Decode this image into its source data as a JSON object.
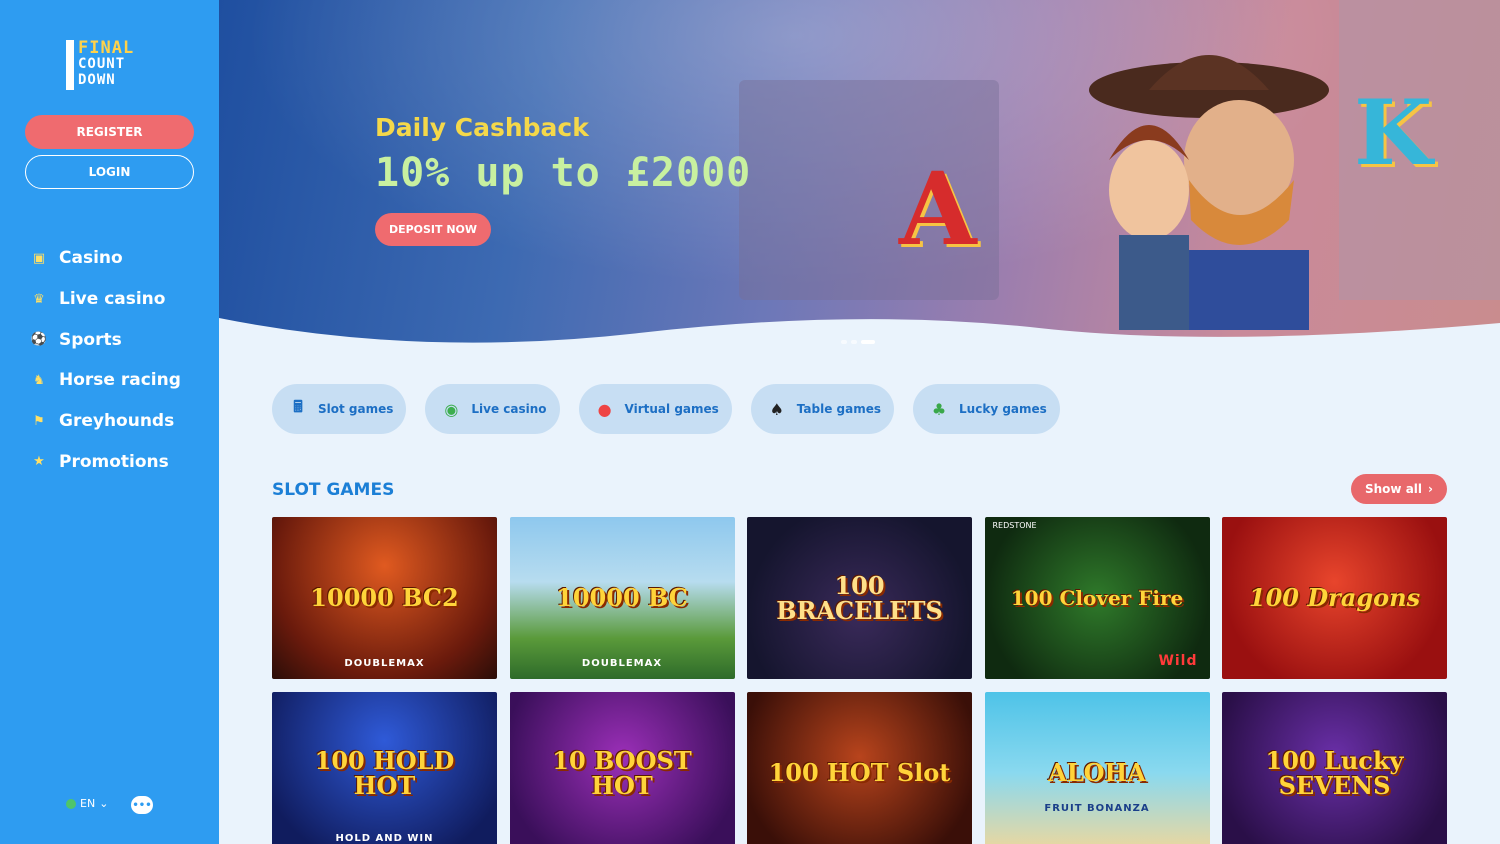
{
  "logo": {
    "line1": "FINAL",
    "line2": "COUNT",
    "line3": "DOWN"
  },
  "auth": {
    "register": "REGISTER",
    "login": "LOGIN"
  },
  "nav": [
    {
      "label": "Casino",
      "icon": "slot-machine-icon"
    },
    {
      "label": "Live casino",
      "icon": "dealer-icon"
    },
    {
      "label": "Sports",
      "icon": "football-icon"
    },
    {
      "label": "Horse racing",
      "icon": "horse-icon"
    },
    {
      "label": "Greyhounds",
      "icon": "greyhound-icon"
    },
    {
      "label": "Promotions",
      "icon": "megaphone-icon"
    }
  ],
  "footer": {
    "language": "EN",
    "chat_icon": "chat-icon"
  },
  "hero": {
    "title": "Daily Cashback",
    "amount": "10% up to £2000",
    "cta": "DEPOSIT NOW",
    "slides": 3,
    "active_slide": 3
  },
  "categories": [
    {
      "label": "Slot games",
      "icon": "slot-machine-icon"
    },
    {
      "label": "Live casino",
      "icon": "roulette-icon"
    },
    {
      "label": "Virtual games",
      "icon": "billiard-ball-icon"
    },
    {
      "label": "Table games",
      "icon": "playing-card-icon"
    },
    {
      "label": "Lucky games",
      "icon": "clover-icon"
    }
  ],
  "slots": {
    "title": "SLOT GAMES",
    "show_all": "Show all",
    "games": [
      {
        "name": "10000 BC2",
        "sub": "DOUBLEMAX",
        "brand": ""
      },
      {
        "name": "10000 BC",
        "sub": "DOUBLEMAX",
        "brand": ""
      },
      {
        "name": "100 BRACELETS",
        "sub": "",
        "brand": ""
      },
      {
        "name": "100 Clover Fire",
        "sub": "Wild",
        "brand": "REDSTONE"
      },
      {
        "name": "100 Dragons",
        "sub": "",
        "brand": ""
      },
      {
        "name": "100 HOLD HOT",
        "sub": "HOLD AND WIN",
        "brand": ""
      },
      {
        "name": "10 BOOST HOT",
        "sub": "",
        "brand": ""
      },
      {
        "name": "100 HOT Slot",
        "sub": "",
        "brand": ""
      },
      {
        "name": "ALOHA",
        "sub": "FRUIT BONANZA",
        "brand": ""
      },
      {
        "name": "100 Lucky SEVENS",
        "sub": "",
        "brand": ""
      }
    ]
  }
}
